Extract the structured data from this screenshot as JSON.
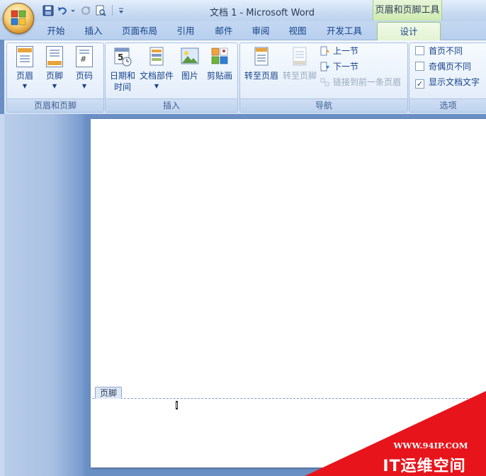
{
  "window": {
    "title": "文档 1 - Microsoft Word",
    "context_tab_group": "页眉和页脚工具"
  },
  "quick_access": {
    "icons": [
      "save-icon",
      "undo-icon",
      "redo-icon",
      "print-preview-icon",
      "customize-dropdown-icon"
    ]
  },
  "tabs": [
    {
      "label": "开始"
    },
    {
      "label": "插入"
    },
    {
      "label": "页面布局"
    },
    {
      "label": "引用"
    },
    {
      "label": "邮件"
    },
    {
      "label": "审阅"
    },
    {
      "label": "视图"
    },
    {
      "label": "开发工具"
    },
    {
      "label": "设计",
      "active": true
    }
  ],
  "ribbon": {
    "header_footer_group": {
      "label": "页眉和页脚",
      "buttons": [
        {
          "label": "页眉",
          "icon": "header-icon"
        },
        {
          "label": "页脚",
          "icon": "footer-icon"
        },
        {
          "label": "页码",
          "icon": "page-number-icon"
        }
      ]
    },
    "insert_group": {
      "label": "插入",
      "buttons": [
        {
          "label_line1": "日期和",
          "label_line2": "时间",
          "icon": "date-time-icon"
        },
        {
          "label": "文档部件",
          "icon": "quick-parts-icon"
        },
        {
          "label": "图片",
          "icon": "picture-icon"
        },
        {
          "label": "剪贴画",
          "icon": "clip-art-icon"
        }
      ]
    },
    "navigation_group": {
      "label": "导航",
      "buttons": [
        {
          "label": "转至页眉",
          "icon": "go-to-header-icon",
          "enabled": true
        },
        {
          "label": "转至页脚",
          "icon": "go-to-footer-icon",
          "enabled": false
        }
      ],
      "small_buttons": [
        {
          "label": "上一节",
          "icon": "previous-section-icon",
          "enabled": true
        },
        {
          "label": "下一节",
          "icon": "next-section-icon",
          "enabled": true
        },
        {
          "label": "链接到前一条页眉",
          "icon": "link-to-previous-icon",
          "enabled": false
        }
      ]
    },
    "options_group": {
      "label": "选项",
      "checkboxes": [
        {
          "label": "首页不同",
          "checked": false
        },
        {
          "label": "奇偶页不同",
          "checked": false
        },
        {
          "label": "显示文档文字",
          "checked": true
        }
      ]
    }
  },
  "document": {
    "footer_tag": "页脚"
  },
  "watermark": {
    "url": "WWW.94IP.COM",
    "brand": "IT运维空间"
  },
  "colors": {
    "accent_text": "#15428b",
    "context_tab": "#e3f3d2",
    "watermark_red": "#e8141b"
  }
}
